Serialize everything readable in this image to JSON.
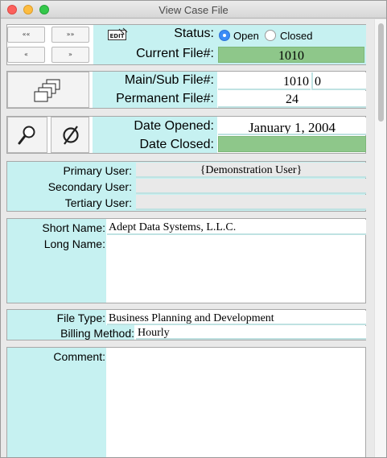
{
  "window": {
    "title": "View Case File"
  },
  "nav": {
    "first_label": "««",
    "last_label": "»»",
    "prev_label": "«",
    "next_label": "»",
    "edit_label": "EDIT"
  },
  "status": {
    "label": "Status:",
    "options": [
      {
        "label": "Open",
        "selected": true
      },
      {
        "label": "Closed",
        "selected": false
      }
    ]
  },
  "current_file": {
    "label": "Current File#:",
    "value": "1010"
  },
  "main_sub_file": {
    "label": "Main/Sub File#:",
    "main": "1010",
    "sub": "0"
  },
  "permanent_file": {
    "label": "Permanent File#:",
    "value": "24"
  },
  "tools": {
    "find_icon": "magnifier-icon",
    "clear_icon": "empty-set-icon",
    "files_icon": "stacked-files-icon"
  },
  "date_opened": {
    "label": "Date Opened:",
    "value": "January 1, 2004"
  },
  "date_closed": {
    "label": "Date Closed:",
    "value": ""
  },
  "users": {
    "primary_label": "Primary User:",
    "primary_value": "{Demonstration User}",
    "secondary_label": "Secondary User:",
    "secondary_value": "",
    "tertiary_label": "Tertiary User:",
    "tertiary_value": ""
  },
  "names": {
    "short_label": "Short Name:",
    "short_value": "Adept Data Systems, L.L.C.",
    "long_label": "Long Name:",
    "long_value": ""
  },
  "file_type": {
    "label": "File Type:",
    "value": "Business Planning and Development"
  },
  "billing": {
    "label": "Billing Method:",
    "value": "Hourly"
  },
  "comment": {
    "label": "Comment:",
    "value": ""
  },
  "colors": {
    "accent_cyan": "#c6f1f1",
    "status_green": "#8ec78a",
    "radio_blue": "#3b8cf7"
  }
}
